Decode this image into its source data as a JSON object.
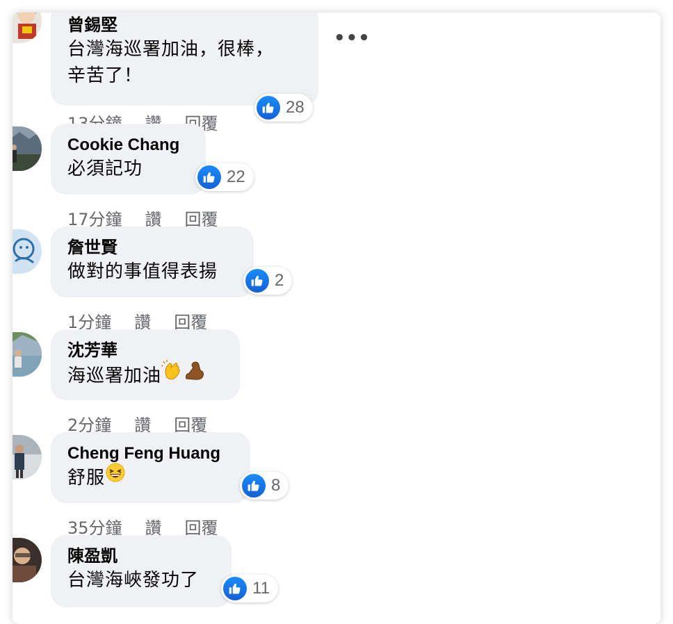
{
  "comments": [
    {
      "author": "曾錫堅",
      "text": "台灣海巡署加油，很棒，",
      "text2": "辛苦了！",
      "likes": "28",
      "time": "13分鐘",
      "like_label": "讚",
      "reply_label": "回覆",
      "more_label": "•••"
    },
    {
      "author": "Cookie Chang",
      "text": "必須記功",
      "likes": "22",
      "time": "17分鐘",
      "like_label": "讚",
      "reply_label": "回覆"
    },
    {
      "author": "詹世賢",
      "text": "做對的事值得表揚",
      "likes": "2",
      "time": "1分鐘",
      "like_label": "讚",
      "reply_label": "回覆"
    },
    {
      "author": "沈芳華",
      "text": "海巡署加油",
      "emoji": [
        "clapping-hands-emoji",
        "flexed-biceps-emoji"
      ],
      "time": "2分鐘",
      "like_label": "讚",
      "reply_label": "回覆"
    },
    {
      "author": "Cheng Feng Huang",
      "text": "舒服",
      "emoji": [
        "laughing-face-emoji"
      ],
      "likes": "8",
      "time": "35分鐘",
      "like_label": "讚",
      "reply_label": "回覆"
    },
    {
      "author": "陳盈凱",
      "text": "台灣海峽發功了",
      "likes": "11"
    }
  ],
  "colors": {
    "bubble": "#eff1f4",
    "like_blue": "#1877f2",
    "meta_text": "#65676b",
    "text": "#050505"
  },
  "icons": {
    "like": "thumbs-up-icon",
    "more": "more-horizontal-icon"
  }
}
